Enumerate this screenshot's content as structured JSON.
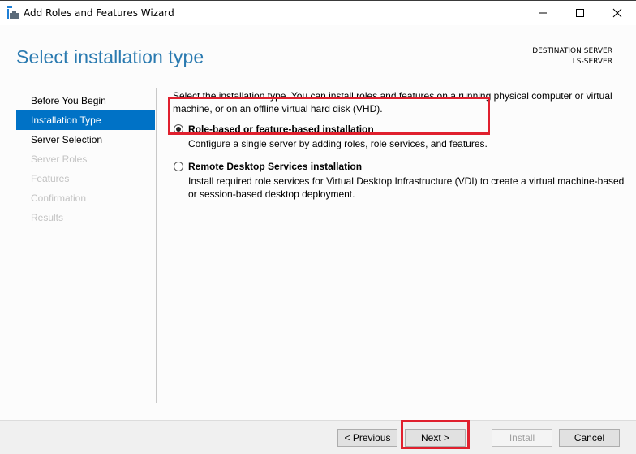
{
  "window": {
    "title": "Add Roles and Features Wizard",
    "icon": "server-manager-wizard-icon",
    "controls": [
      "minimize",
      "maximize",
      "close"
    ]
  },
  "header": {
    "page_title": "Select installation type",
    "destination_label": "DESTINATION SERVER",
    "destination_server": "LS-SERVER"
  },
  "nav": {
    "items": [
      {
        "label": "Before You Begin",
        "state": "enabled"
      },
      {
        "label": "Installation Type",
        "state": "active"
      },
      {
        "label": "Server Selection",
        "state": "enabled"
      },
      {
        "label": "Server Roles",
        "state": "disabled"
      },
      {
        "label": "Features",
        "state": "disabled"
      },
      {
        "label": "Confirmation",
        "state": "disabled"
      },
      {
        "label": "Results",
        "state": "disabled"
      }
    ]
  },
  "content": {
    "intro": "Select the installation type. You can install roles and features on a running physical computer or virtual machine, or on an offline virtual hard disk (VHD).",
    "options": [
      {
        "label": "Role-based or feature-based installation",
        "description": "Configure a single server by adding roles, role services, and features.",
        "selected": true
      },
      {
        "label": "Remote Desktop Services installation",
        "description": "Install required role services for Virtual Desktop Infrastructure (VDI) to create a virtual machine-based or session-based desktop deployment.",
        "selected": false
      }
    ]
  },
  "footer": {
    "previous_label": "< Previous",
    "next_label": "Next >",
    "install_label": "Install",
    "cancel_label": "Cancel"
  },
  "colors": {
    "accent": "#0072c6",
    "title": "#2a7ab0",
    "highlight": "#e0202e"
  }
}
